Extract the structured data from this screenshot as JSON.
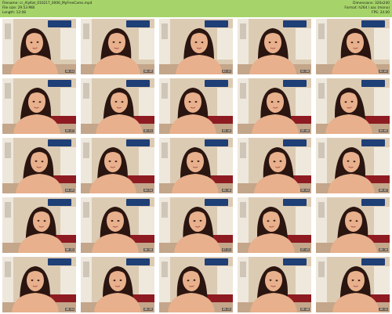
{
  "header": {
    "filename": "Filename: cr_AlyKat_010217_0006_MyFreeCams.mp4",
    "filesize": "File size: 29.53 MiB",
    "length": "Length: 12:08",
    "dimensions": "Dimensions: 320x240",
    "format": "Format: h264 / aac (mono)",
    "fps": "FPS: 24.00"
  },
  "colors": {
    "header_bg": "#a6d46a",
    "sheet_bg": "#ffffff",
    "wall": "#dccbb3",
    "hair": "#2b1510",
    "skin": "#e8b08c",
    "banner": "#1f3f77",
    "couch": "#8e1b22"
  },
  "thumbnails": [
    {
      "time": "00:24"
    },
    {
      "time": "00:49"
    },
    {
      "time": "01:13"
    },
    {
      "time": "01:38"
    },
    {
      "time": "02:02"
    },
    {
      "time": "02:27"
    },
    {
      "time": "02:51"
    },
    {
      "time": "03:16"
    },
    {
      "time": "03:40"
    },
    {
      "time": "04:05"
    },
    {
      "time": "04:29"
    },
    {
      "time": "04:54"
    },
    {
      "time": "05:18"
    },
    {
      "time": "05:43"
    },
    {
      "time": "06:07"
    },
    {
      "time": "06:32"
    },
    {
      "time": "06:56"
    },
    {
      "time": "07:21"
    },
    {
      "time": "07:45"
    },
    {
      "time": "08:10"
    },
    {
      "time": "08:34"
    },
    {
      "time": "08:59"
    },
    {
      "time": "09:23"
    },
    {
      "time": "09:48"
    },
    {
      "time": "10:12"
    }
  ]
}
